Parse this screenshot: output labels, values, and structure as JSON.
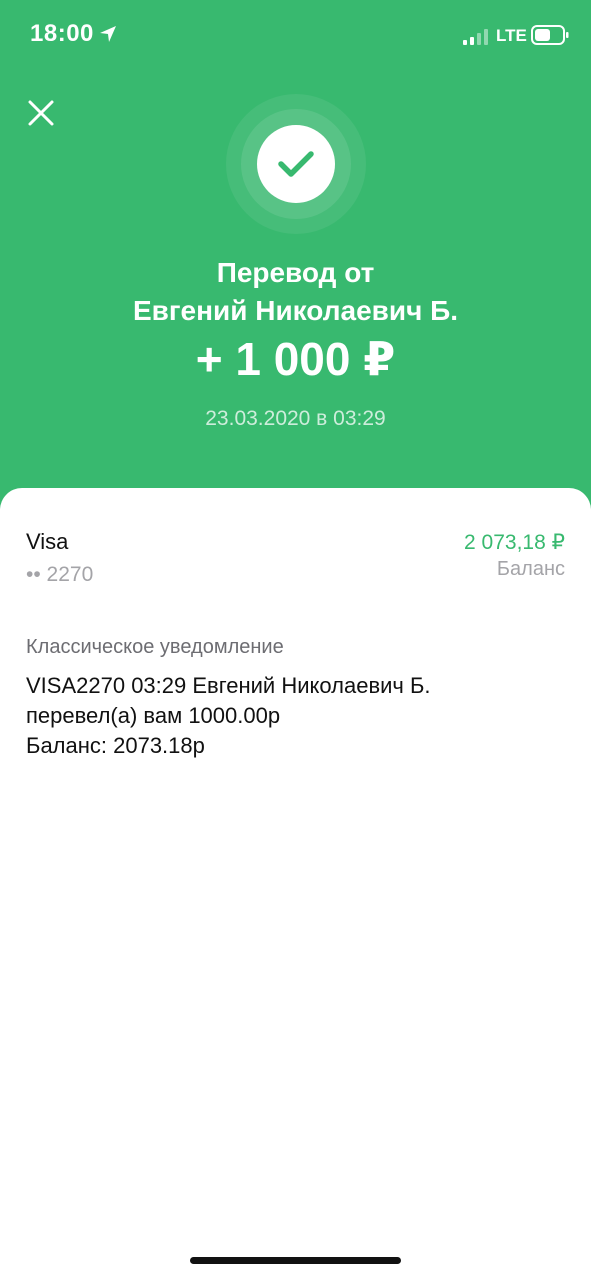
{
  "status_bar": {
    "time": "18:00",
    "network": "LTE"
  },
  "colors": {
    "accent_green": "#38b96f",
    "muted_text": "#a4a4a8"
  },
  "header": {
    "title_line1": "Перевод от",
    "title_line2": "Евгений Николаевич Б.",
    "amount": "+ 1 000 ₽",
    "datetime": "23.03.2020 в 03:29"
  },
  "account": {
    "card_name": "Visa",
    "card_number": "•• 2270",
    "balance_value": "2 073,18 ₽",
    "balance_label": "Баланс"
  },
  "notification": {
    "label": "Классическое уведомление",
    "line1": "VISA2270 03:29 Евгений Николаевич Б.",
    "line2": "перевел(а) вам 1000.00р",
    "line3": "Баланс: 2073.18р"
  }
}
